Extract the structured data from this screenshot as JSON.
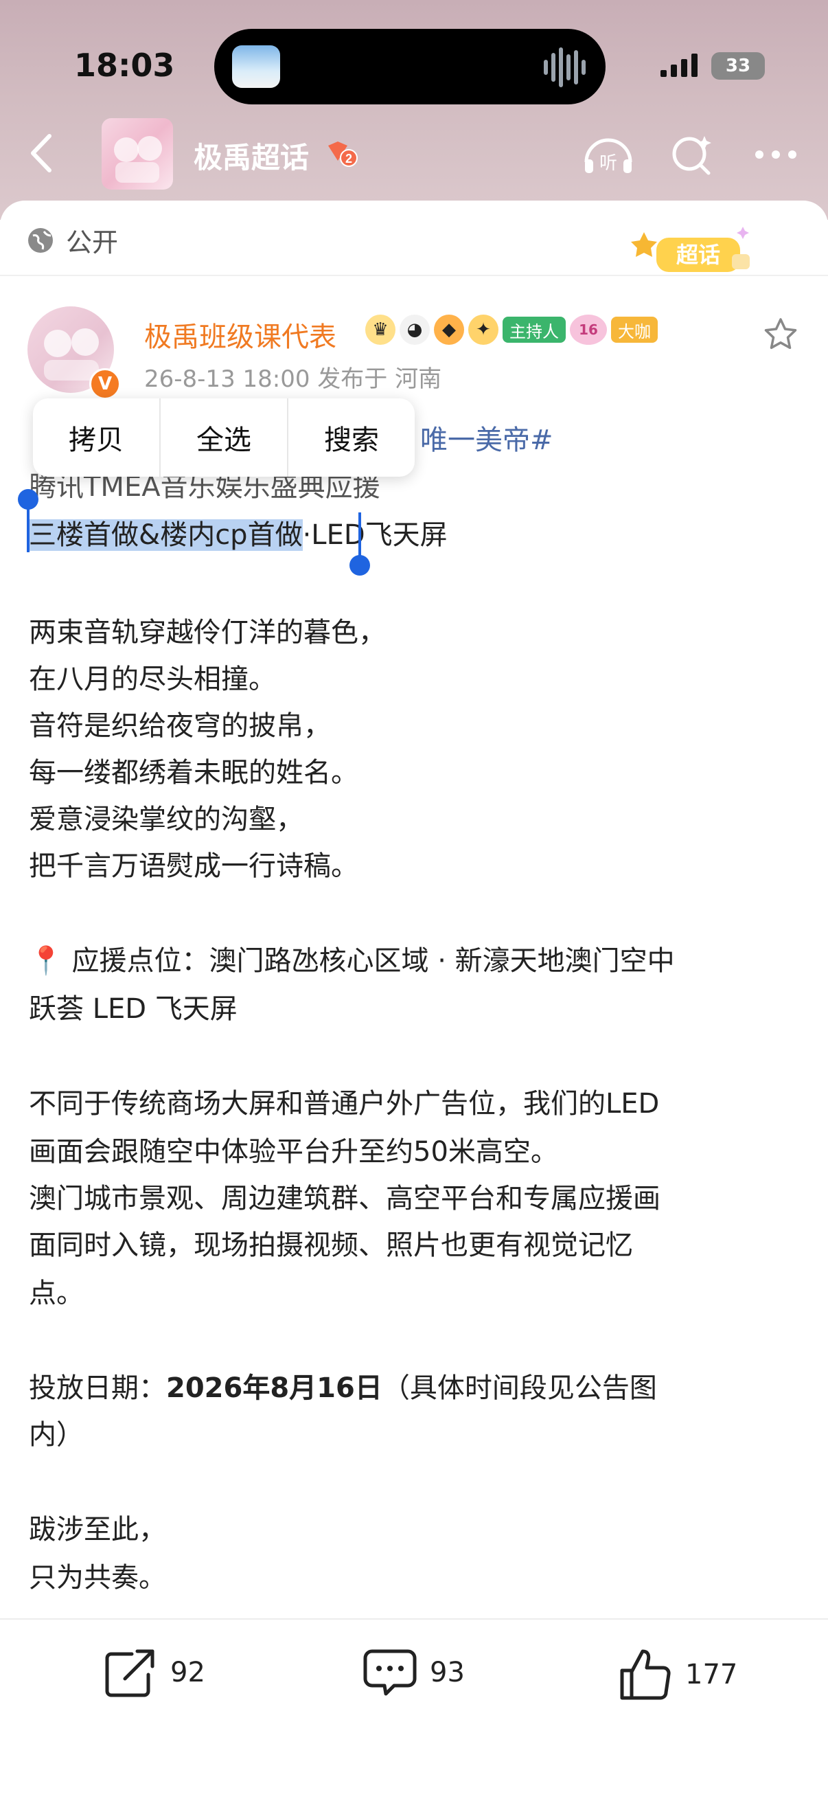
{
  "status_bar": {
    "time": "18:03",
    "battery": "33"
  },
  "nav": {
    "title": "极禹超话",
    "level": "2",
    "listen_label": "听"
  },
  "card": {
    "privacy": "公开",
    "chaohua_badge": "超话"
  },
  "post": {
    "author": "极禹班级课代表",
    "badges": {
      "host": "主持人",
      "fans_level": "16",
      "big_shot": "大咖",
      "verified": "V"
    },
    "meta": "26-8-13 18:00  发布于 河南",
    "hashtag_partial": "唯一美帝#",
    "line_occluded": "腾讯TMEA音乐娱乐盛典应援",
    "line_selected": "三楼首做&楼内cp首做",
    "line_selected_tail": "·LED飞天屏",
    "poem": [
      "两束音轨穿越伶仃洋的暮色，",
      "在八月的尽头相撞。",
      "音符是织给夜穹的披帛，",
      "每一缕都绣着未眠的姓名。",
      "爱意浸染掌纹的沟壑，",
      "把千言万语熨成一行诗稿。"
    ],
    "location_line1": "📍 应援点位：澳门路氹核心区域 · 新濠天地澳门空中",
    "location_line2": "跃荟 LED 飞天屏",
    "desc": [
      "不同于传统商场大屏和普通户外广告位，我们的LED",
      "画面会跟随空中体验平台升至约50米高空。",
      "澳门城市景观、周边建筑群、高空平台和专属应援画",
      "面同时入镜，现场拍摄视频、照片也更有视觉记忆",
      "点。"
    ],
    "date_label": "投放日期：",
    "date_value": "2026年8月16日",
    "date_tail": "（具体时间段见公告图",
    "date_line2": "内）",
    "ending": [
      "跋涉至此，",
      "只为共奏。"
    ]
  },
  "context_menu": {
    "copy": "拷贝",
    "select_all": "全选",
    "search": "搜索"
  },
  "footer": {
    "share_count": "92",
    "comment_count": "93",
    "like_count": "177"
  },
  "colors": {
    "accent_orange": "#f07a22",
    "hashtag_blue": "#4a6aa8",
    "selection": "#b9d2f2",
    "handle": "#1f64e0"
  }
}
